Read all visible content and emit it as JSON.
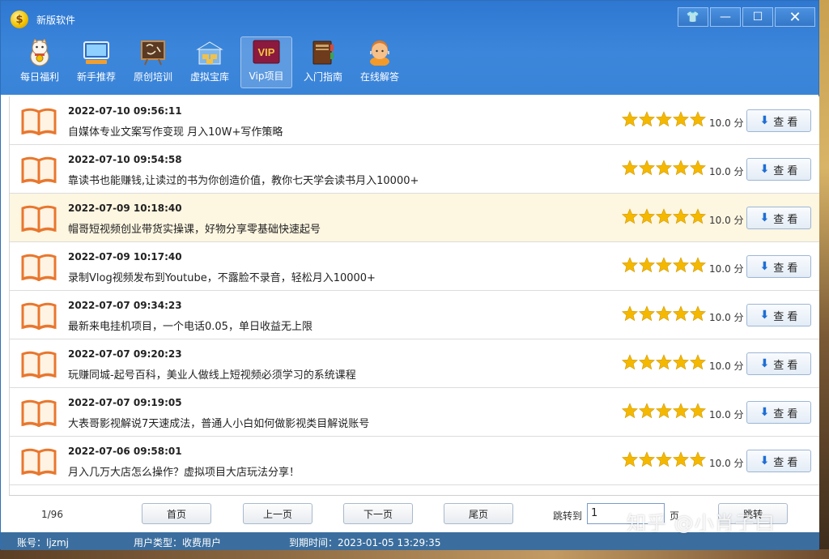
{
  "window": {
    "title": "新版软件",
    "controls": {
      "skin": "👕",
      "minimize": "—",
      "maximize": "☐",
      "close": "✕"
    }
  },
  "toolbar": [
    {
      "label": "每日福利",
      "icon": "lucky-cat-icon"
    },
    {
      "label": "新手推荐",
      "icon": "monitor-icon"
    },
    {
      "label": "原创培训",
      "icon": "blackboard-icon"
    },
    {
      "label": "虚拟宝库",
      "icon": "warehouse-icon"
    },
    {
      "label": "Vip项目",
      "icon": "vip-icon",
      "active": true,
      "badge": "VIP"
    },
    {
      "label": "入门指南",
      "icon": "book-stack-icon"
    },
    {
      "label": "在线解答",
      "icon": "support-agent-icon"
    }
  ],
  "list": {
    "view_label": "查 看",
    "score_suffix": "分",
    "items": [
      {
        "date": "2022-07-10 09:56:11",
        "title": "自媒体专业文案写作变现 月入10W+写作策略",
        "score": "10.0",
        "stars": 5
      },
      {
        "date": "2022-07-10 09:54:58",
        "title": "靠读书也能赚钱,让读过的书为你创造价值，教你七天学会读书月入10000+",
        "score": "10.0",
        "stars": 5
      },
      {
        "date": "2022-07-09 10:18:40",
        "title": "帽哥短视频创业带货实操课，好物分享零基础快速起号",
        "score": "10.0",
        "stars": 5,
        "highlighted": true
      },
      {
        "date": "2022-07-09 10:17:40",
        "title": "录制Vlog视频发布到Youtube，不露脸不录音，轻松月入10000+",
        "score": "10.0",
        "stars": 5
      },
      {
        "date": "2022-07-07 09:34:23",
        "title": "最新来电挂机项目，一个电话0.05，单日收益无上限",
        "score": "10.0",
        "stars": 5
      },
      {
        "date": "2022-07-07 09:20:23",
        "title": "玩赚同城-起号百科，美业人做线上短视频必须学习的系统课程",
        "score": "10.0",
        "stars": 5
      },
      {
        "date": "2022-07-07 09:19:05",
        "title": "大表哥影视解说7天速成法，普通人小白如何做影视类目解说账号",
        "score": "10.0",
        "stars": 5
      },
      {
        "date": "2022-07-06 09:58:01",
        "title": "月入几万大店怎么操作？虚拟项目大店玩法分享！",
        "score": "10.0",
        "stars": 5
      }
    ]
  },
  "pager": {
    "page_info": "1/96",
    "first": "首页",
    "prev": "上一页",
    "next": "下一页",
    "last": "尾页",
    "jump_label": "跳转到",
    "jump_value": "1",
    "page_unit": "页",
    "jump_button": "跳转"
  },
  "status": {
    "account": "账号：ljzmj",
    "user_type": "用户类型：收费用户",
    "expire": "到期时间：2023-01-05 13:29:35"
  },
  "watermark": "知乎 @小肖子曰",
  "colors": {
    "titlebar": "#3a84d8",
    "statusbar": "#3b6e9e",
    "highlight_row": "#fdf6e1",
    "star": "#f5b800",
    "book": "#e8772e"
  }
}
